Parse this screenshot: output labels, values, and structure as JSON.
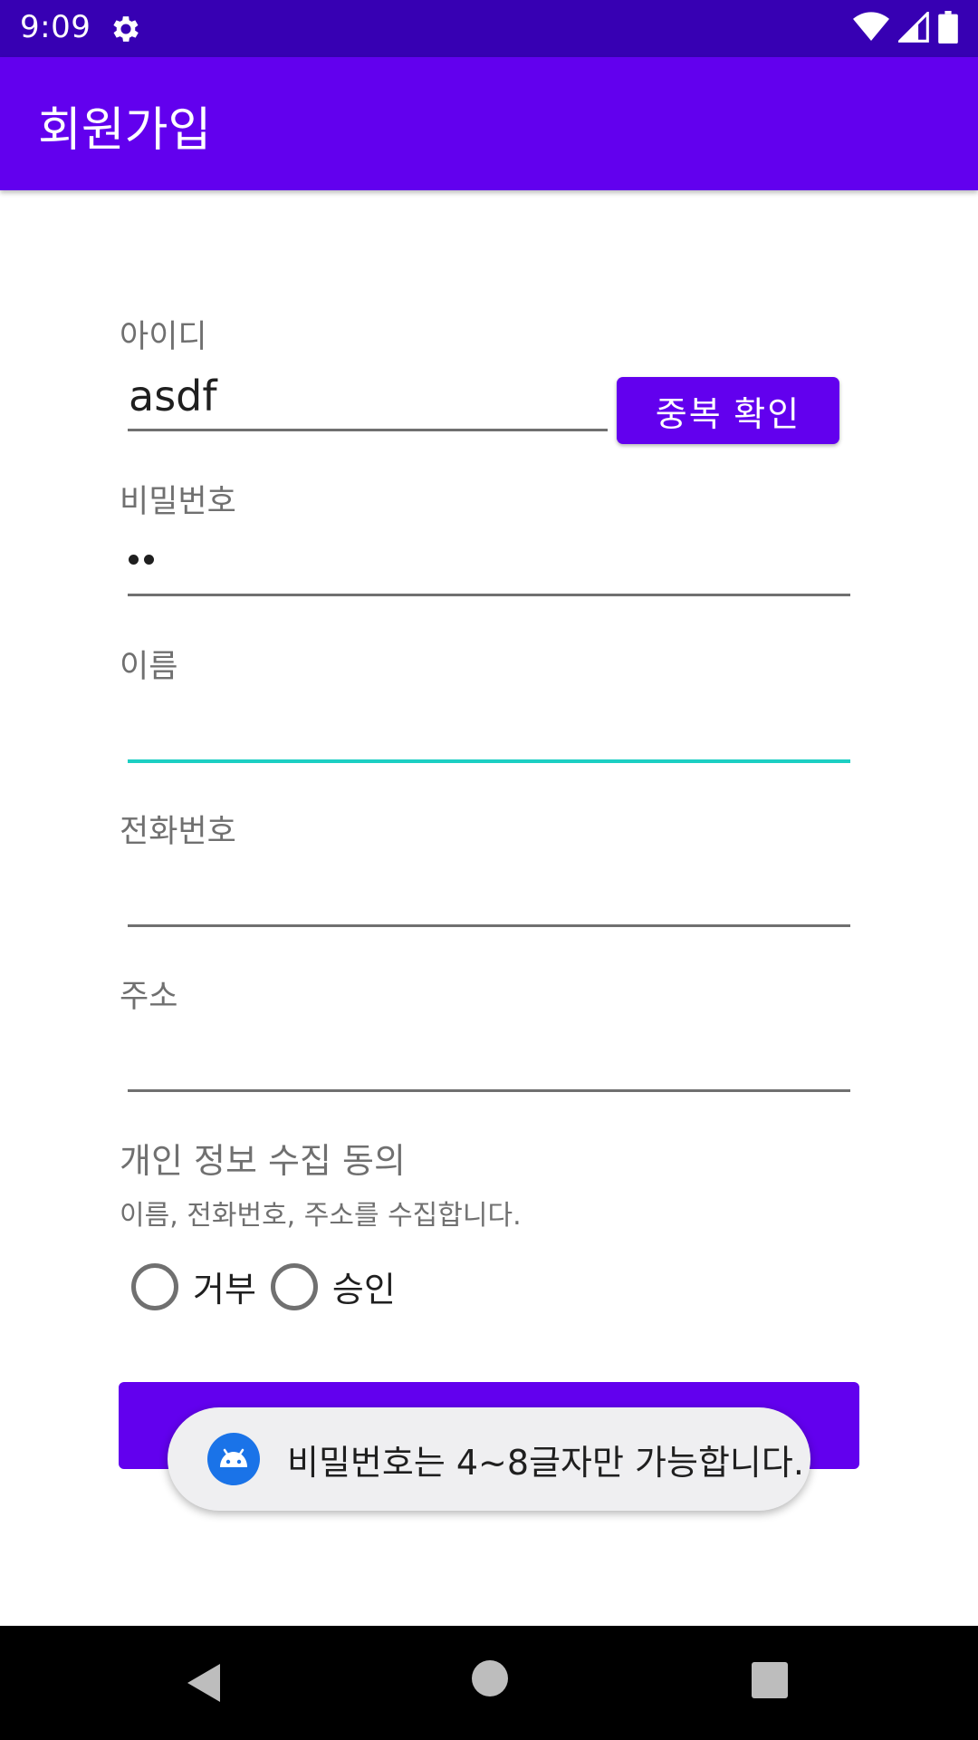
{
  "status_bar": {
    "time": "9:09",
    "icons": [
      "gear-icon",
      "wifi-icon",
      "signal-icon",
      "battery-icon"
    ]
  },
  "app_bar": {
    "title": "회원가입"
  },
  "form": {
    "id_label": "아이디",
    "id_value": "asdf",
    "dup_check_label": "중복 확인",
    "password_label": "비밀번호",
    "password_value": "••",
    "name_label": "이름",
    "name_value": "",
    "phone_label": "전화번호",
    "phone_value": "",
    "address_label": "주소",
    "address_value": ""
  },
  "privacy": {
    "title": "개인 정보 수집 동의",
    "description": "이름, 전화번호, 주소를 수집합니다.",
    "options": [
      {
        "label": "거부",
        "checked": false
      },
      {
        "label": "승인",
        "checked": false
      }
    ]
  },
  "toast": {
    "icon": "android-icon",
    "message": "비밀번호는 4~8글자만 가능합니다."
  },
  "colors": {
    "status_bar": "#3700b3",
    "primary": "#6200ee",
    "focus_underline": "#1ccfc3",
    "toast_bg": "#efeff1"
  }
}
